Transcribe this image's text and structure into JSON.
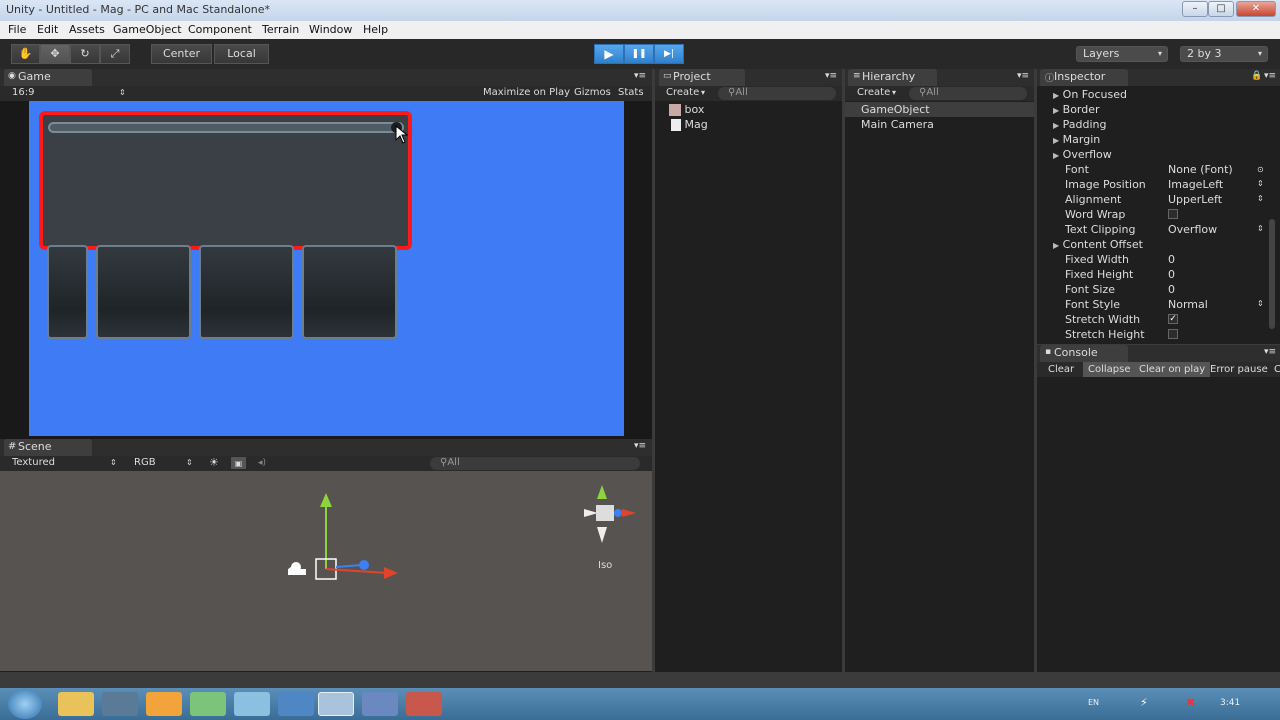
{
  "window": {
    "title": "Unity - Untitled - Mag - PC and Mac Standalone*",
    "minimize": "–",
    "maximize": "□",
    "close": "✕"
  },
  "menu": [
    "File",
    "Edit",
    "Assets",
    "GameObject",
    "Component",
    "Terrain",
    "Window",
    "Help"
  ],
  "toolbar": {
    "hand": "✋",
    "move": "✥",
    "rotate": "↻",
    "scale": "⤢",
    "pivot": "Center",
    "space": "Local",
    "play": "▶",
    "pause": "❚❚",
    "step": "▶|",
    "layers": "Layers",
    "layout": "2 by 3"
  },
  "game": {
    "tab": "Game",
    "aspect": "16:9",
    "maximize": "Maximize on Play",
    "gizmos": "Gizmos",
    "stats": "Stats",
    "bg": "#3f7bf4"
  },
  "scene": {
    "tab": "Scene",
    "render": "Textured",
    "color": "RGB",
    "search": "All",
    "iso": "Iso"
  },
  "project": {
    "tab": "Project",
    "create": "Create",
    "search": "All",
    "items": [
      "box",
      "Mag"
    ]
  },
  "hierarchy": {
    "tab": "Hierarchy",
    "create": "Create",
    "search": "All",
    "items": [
      "GameObject",
      "Main Camera"
    ]
  },
  "inspector": {
    "tab": "Inspector",
    "foldouts": [
      "On Focused",
      "Border",
      "Padding",
      "Margin",
      "Overflow"
    ],
    "props": [
      {
        "label": "Font",
        "value": "None (Font)"
      },
      {
        "label": "Image Position",
        "value": "ImageLeft"
      },
      {
        "label": "Alignment",
        "value": "UpperLeft"
      },
      {
        "label": "Word Wrap",
        "value": ""
      },
      {
        "label": "Text Clipping",
        "value": "Overflow"
      },
      {
        "label": "Content Offset",
        "value": ""
      },
      {
        "label": "Fixed Width",
        "value": "0"
      },
      {
        "label": "Fixed Height",
        "value": "0"
      },
      {
        "label": "Font Size",
        "value": "0"
      },
      {
        "label": "Font Style",
        "value": "Normal"
      },
      {
        "label": "Stretch Width",
        "value": ""
      },
      {
        "label": "Stretch Height",
        "value": ""
      }
    ]
  },
  "console": {
    "tab": "Console",
    "buttons": [
      "Clear",
      "Collapse",
      "Clear on play",
      "Error pause",
      "C"
    ]
  },
  "taskbar": {
    "lang": "EN",
    "time": "3:41"
  }
}
